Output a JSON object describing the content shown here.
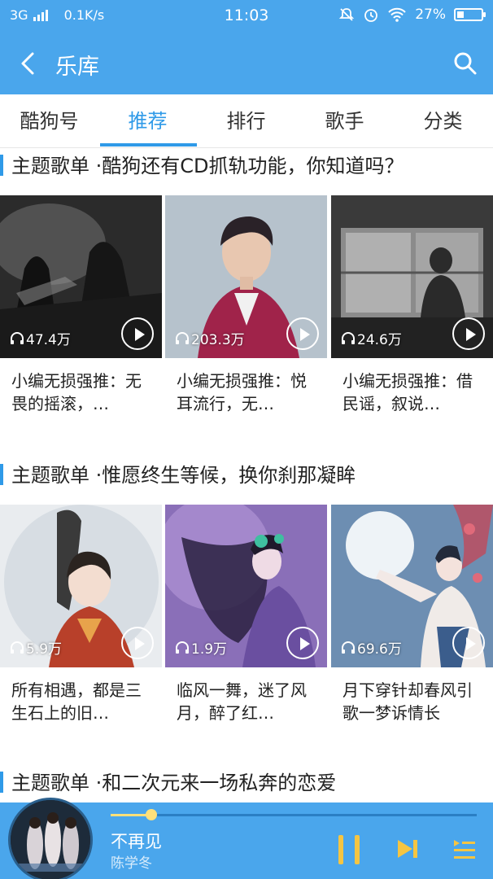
{
  "status": {
    "network": "3G",
    "speed": "0.1K/s",
    "time": "11:03",
    "battery": "27%",
    "battery_level": 0.27
  },
  "appbar": {
    "title": "乐库"
  },
  "tabs": [
    {
      "label": "酷狗号"
    },
    {
      "label": "推荐"
    },
    {
      "label": "排行"
    },
    {
      "label": "歌手"
    },
    {
      "label": "分类"
    }
  ],
  "sections": [
    {
      "label": "主题歌单",
      "subtitle": "·酷狗还有CD抓轨功能，你知道吗？",
      "cards": [
        {
          "plays": "47.4万",
          "title": "小编无损强推：无畏的摇滚，…"
        },
        {
          "plays": "203.3万",
          "title": "小编无损强推：悦耳流行，无…"
        },
        {
          "plays": "24.6万",
          "title": "小编无损强推：借民谣，叙说…"
        }
      ]
    },
    {
      "label": "主题歌单",
      "subtitle": "·惟愿终生等候，换你刹那凝眸",
      "cards": [
        {
          "plays": "5.9万",
          "title": "所有相遇，都是三生石上的旧…"
        },
        {
          "plays": "1.9万",
          "title": "临风一舞，迷了风月，醉了红…"
        },
        {
          "plays": "69.6万",
          "title": "月下穿针却春风引歌一梦诉情长"
        }
      ]
    },
    {
      "label": "主题歌单",
      "subtitle": "·和二次元来一场私奔的恋爱"
    }
  ],
  "player": {
    "song": "不再见",
    "artist": "陈学冬",
    "progress": 0.11,
    "accent": "#ffe07a"
  },
  "colors": {
    "brand": "#4aa6ec",
    "tab_active": "#2f9ae8"
  }
}
